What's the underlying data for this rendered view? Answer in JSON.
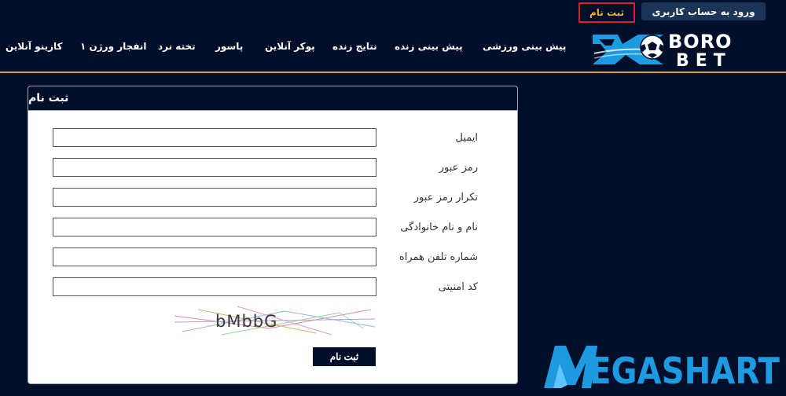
{
  "header": {
    "register_label": "ثبت نام",
    "login_label": "ورود به حساب کاربری"
  },
  "nav": [
    "کازینو آنلاین",
    "انفجار ورژن ۱",
    "تخته نرد",
    "پاسور",
    "پوکر آنلاین",
    "نتایج زنده",
    "پیش بینی زنده",
    "پیش بینی ورزشی"
  ],
  "logo": {
    "text_top": "BORO",
    "text_bottom": "BET",
    "mark": "1X"
  },
  "form": {
    "title": "ثبت نام",
    "fields": [
      {
        "label": "ایمیل",
        "value": ""
      },
      {
        "label": "رمز عبور",
        "value": ""
      },
      {
        "label": "تکرار رمز عبور",
        "value": ""
      },
      {
        "label": "نام و نام خانوادگی",
        "value": ""
      },
      {
        "label": "شماره تلفن همراه",
        "value": ""
      },
      {
        "label": "کد امنیتی",
        "value": ""
      }
    ],
    "captcha_text": "bMbbG",
    "submit_label": "ثبت نام"
  },
  "watermark": "MEGASHART",
  "colors": {
    "background": "#020f2a",
    "accent": "#d4a433",
    "register_text": "#f2b233",
    "highlight_border": "#e01f1f",
    "logo_blue": "#1e9be0"
  }
}
